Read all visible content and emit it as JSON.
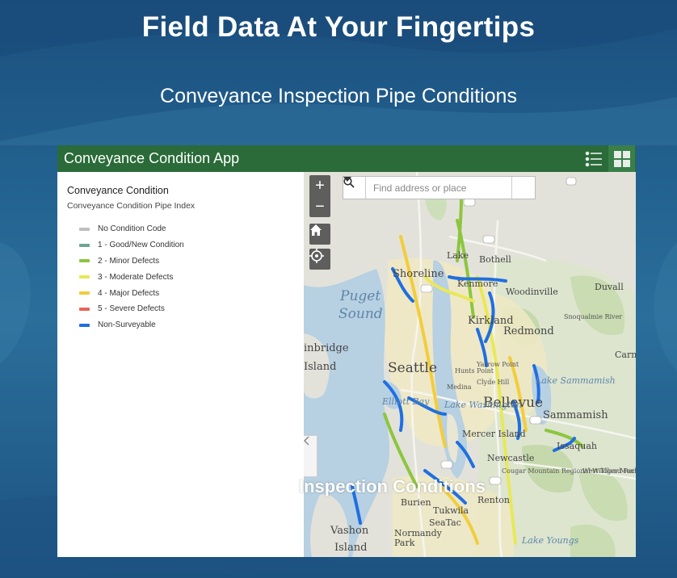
{
  "slide": {
    "title": "Field Data At Your Fingertips",
    "subtitle": "Conveyance Inspection Pipe Conditions",
    "overlay_text": "Inspection Conditions"
  },
  "app": {
    "title": "Conveyance Condition App",
    "header_color": "#2a6b39",
    "legend_button_icon": "legend-list-icon",
    "layers_button_icon": "grid-apps-icon"
  },
  "legend": {
    "title": "Conveyance Condition",
    "subtitle": "Conveyance Condition Pipe Index",
    "items": [
      {
        "label": "No Condition Code",
        "color": "#bfbfbf"
      },
      {
        "label": "1 - Good/New Condition",
        "color": "#6fa592"
      },
      {
        "label": "2 - Minor Defects",
        "color": "#8cc63f"
      },
      {
        "label": "3 - Moderate Defects",
        "color": "#e8e85a"
      },
      {
        "label": "4 - Major Defects",
        "color": "#f2cd3c"
      },
      {
        "label": "5 - Severe Defects",
        "color": "#e8655a"
      },
      {
        "label": "Non-Surveyable",
        "color": "#1f6fe0"
      }
    ]
  },
  "map": {
    "search_placeholder": "Find address or place",
    "zoom_in": "+",
    "zoom_out": "−",
    "labels": {
      "puget": "Puget",
      "sound": "Sound",
      "shoreline": "Shoreline",
      "lake": "Lake",
      "bothell": "Bothell",
      "kenmore": "Kenmore",
      "woodinville": "Woodinville",
      "duvall": "Duvall",
      "kirkland": "Kirkland",
      "redmond": "Redmond",
      "bainbridge": "inbridge",
      "island": "Island",
      "seattle": "Seattle",
      "yarrow_point": "Yarrow Point",
      "hunts_point": "Hunts Point",
      "medina": "Medina",
      "clyde_hill": "Clyde Hill",
      "bellevue": "Bellevue",
      "lake_sammamish": "Lake Sammamish",
      "sammamish": "Sammamish",
      "lake_washington": "Lake Washington",
      "elliott_bay": "Elliott Bay",
      "mercer_island": "Mercer Island",
      "issaquah": "Issaquah",
      "newcastle": "Newcastle",
      "cougar_mountain": "Cougar Mountain Regional Wildland Park",
      "west_tiger": "West Tiger Mountain NRCA",
      "carnation": "Carna",
      "snoqualmie_river": "Snoqualmie River",
      "burien": "Burien",
      "tukwila": "Tukwila",
      "renton": "Renton",
      "seatac": "SeaTac",
      "vashon": "Vashon",
      "vashon_island": "Island",
      "normandy_park": "Normandy Park",
      "lake_youngs": "Lake Youngs"
    }
  }
}
